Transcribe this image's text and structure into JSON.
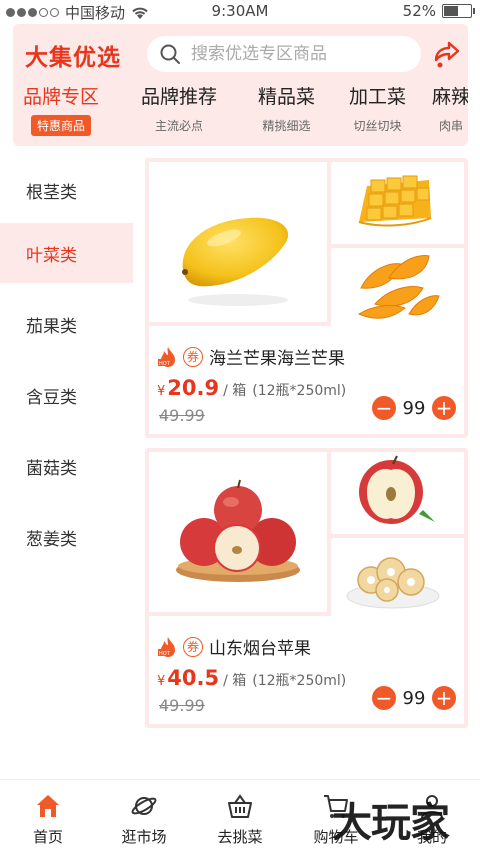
{
  "status": {
    "carrier": "中国移动",
    "time": "9:30AM",
    "battery": "52%",
    "battery_level": 0.52
  },
  "header": {
    "logo": "大集优选",
    "search_placeholder": "搜索优选专区商品",
    "categories": [
      {
        "title": "品牌专区",
        "sub": "特惠商品"
      },
      {
        "title": "品牌推荐",
        "sub": "主流必点"
      },
      {
        "title": "精品菜",
        "sub": "精挑细选"
      },
      {
        "title": "加工菜",
        "sub": "切丝切块"
      },
      {
        "title": "麻辣",
        "sub": "肉串"
      }
    ]
  },
  "sidebar": {
    "items": [
      "根茎类",
      "叶菜类",
      "茄果类",
      "含豆类",
      "菌菇类",
      "葱姜类"
    ]
  },
  "products": [
    {
      "coupon": "券",
      "name": "海兰芒果海兰芒果",
      "yen": "¥",
      "price": "20.9",
      "unit": "/ 箱",
      "spec": "(12瓶*250ml)",
      "old_price": "49.99",
      "qty": "99",
      "minus": "−",
      "plus": "+"
    },
    {
      "coupon": "券",
      "name": "山东烟台苹果",
      "yen": "¥",
      "price": "40.5",
      "unit": "/ 箱",
      "spec": "(12瓶*250ml)",
      "old_price": "49.99",
      "qty": "99",
      "minus": "−",
      "plus": "+"
    }
  ],
  "tabs": [
    {
      "label": "首页",
      "icon": "home-icon"
    },
    {
      "label": "逛市场",
      "icon": "planet-icon"
    },
    {
      "label": "去挑菜",
      "icon": "basket-icon"
    },
    {
      "label": "购物车",
      "icon": "cart-icon"
    },
    {
      "label": "我的",
      "icon": "user-icon"
    }
  ],
  "watermark": "大玩家",
  "colors": {
    "accent": "#ef5a28",
    "brand_red": "#e8361d",
    "pale": "#fde9e8"
  }
}
